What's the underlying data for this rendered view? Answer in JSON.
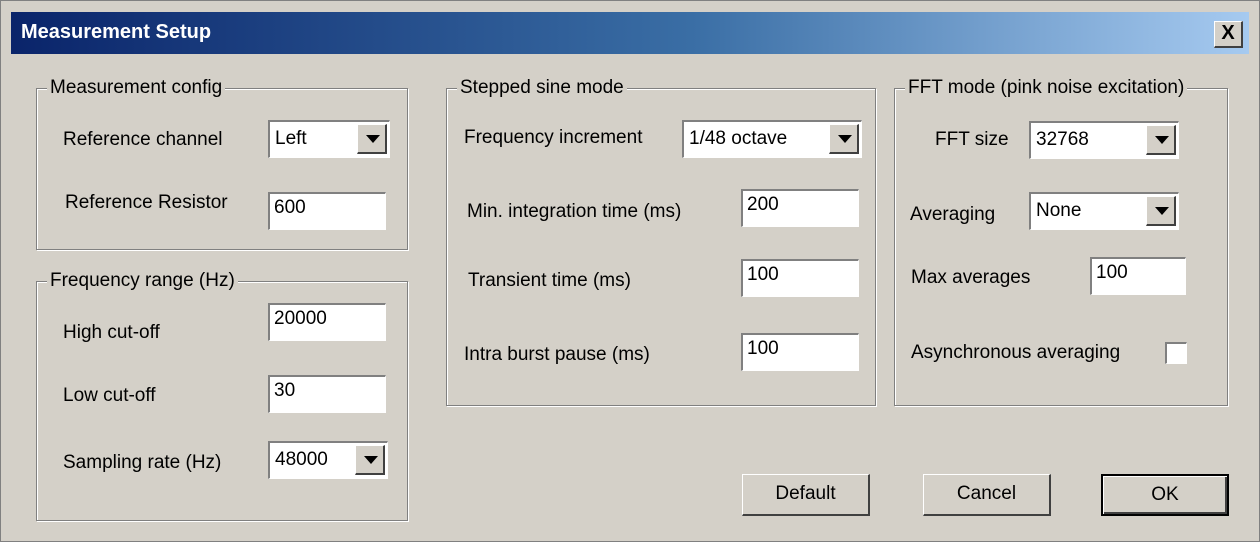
{
  "window": {
    "title": "Measurement Setup",
    "close_label": "X"
  },
  "measurement_config": {
    "title": "Measurement config",
    "reference_channel": {
      "label": "Reference channel",
      "value": "Left"
    },
    "reference_resistor": {
      "label": "Reference Resistor",
      "value": "600"
    }
  },
  "frequency_range": {
    "title": "Frequency range (Hz)",
    "high_cutoff": {
      "label": "High cut-off",
      "value": "20000"
    },
    "low_cutoff": {
      "label": "Low cut-off",
      "value": "30"
    },
    "sampling_rate": {
      "label": "Sampling rate (Hz)",
      "value": "48000"
    }
  },
  "stepped_sine": {
    "title": "Stepped sine mode",
    "frequency_increment": {
      "label": "Frequency increment",
      "value": "1/48 octave"
    },
    "min_integration": {
      "label": "Min. integration time (ms)",
      "value": "200"
    },
    "transient": {
      "label": "Transient time (ms)",
      "value": "100"
    },
    "intra_burst": {
      "label": "Intra burst pause (ms)",
      "value": "100"
    }
  },
  "fft_mode": {
    "title": "FFT mode (pink noise excitation)",
    "fft_size": {
      "label": "FFT size",
      "value": "32768"
    },
    "averaging": {
      "label": "Averaging",
      "value": "None"
    },
    "max_averages": {
      "label": "Max averages",
      "value": "100"
    },
    "async_averaging": {
      "label": "Asynchronous averaging",
      "checked": false
    }
  },
  "buttons": {
    "default": "Default",
    "cancel": "Cancel",
    "ok": "OK"
  }
}
